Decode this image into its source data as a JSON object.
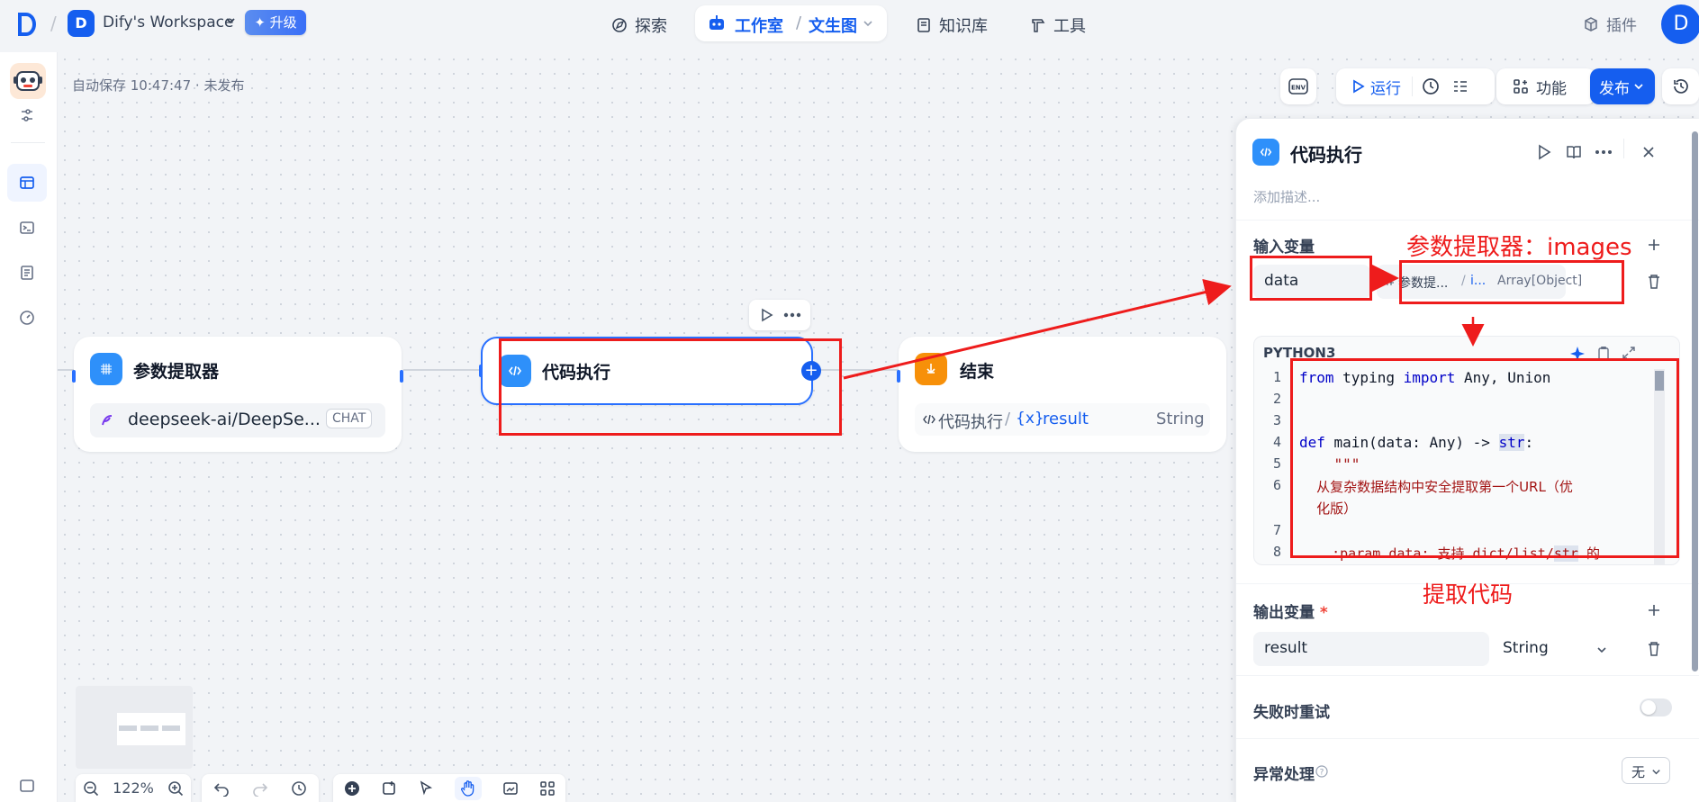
{
  "topbar": {
    "workspace_initial": "D",
    "workspace_name": "Dify's Workspace",
    "upgrade_label": "✦ 升级",
    "nav": {
      "explore": "探索",
      "studio": "工作室",
      "studio_sep": "/",
      "current_app": "文生图",
      "knowledge": "知识库",
      "tools": "工具"
    },
    "plugins": "插件",
    "avatar_initial": "D"
  },
  "canvas": {
    "autosave": "自动保存 10:47:47 · 未发布",
    "toolbar": {
      "env": "ENV",
      "run": "运行",
      "features": "功能",
      "publish": "发布"
    },
    "zoom": "122%"
  },
  "nodes": {
    "param_extractor": {
      "title": "参数提取器",
      "model": "deepseek-ai/DeepSe...",
      "badge": "CHAT"
    },
    "code": {
      "title": "代码执行"
    },
    "end": {
      "title": "结束",
      "var_source": "代码执行",
      "var_sep": "/",
      "var_name": "result",
      "var_type": "String"
    }
  },
  "panel": {
    "title": "代码执行",
    "description_placeholder": "添加描述...",
    "input_vars_label": "输入变量",
    "input_var_name": "data",
    "input_var_source": "参数提...",
    "input_var_sep": "/",
    "input_var_field": "i...",
    "input_var_type": "Array[Object]",
    "language": "PYTHON3",
    "code_lines": [
      "1",
      "2",
      "3",
      "4",
      "5",
      "6",
      "7",
      "8"
    ],
    "code": {
      "l1_a": "from",
      "l1_b": " typing ",
      "l1_c": "import",
      "l1_d": " Any, Union",
      "l4_a": "def",
      "l4_b": " main(data: Any) -> ",
      "l4_c": "str",
      "l4_d": ":",
      "l5": "    \"\"\"",
      "l6a": "    从复杂数据结构中安全提取第一个URL（优",
      "l6b": "    化版）",
      "l8_a": "    :param data: 支持 dict/list/",
      "l8_b": "str",
      "l8_c": " 的"
    },
    "output_vars_label": "输出变量",
    "output_required": "*",
    "output_var_name": "result",
    "output_var_type": "String",
    "retry_label": "失败时重试",
    "error_label": "异常处理",
    "error_value": "无"
  },
  "annotations": {
    "extractor_label": "参数提取器：images",
    "code_label": "提取代码"
  },
  "colors": {
    "primary": "#155eef",
    "annotation_red": "#ee1c1c",
    "extractor_blue": "#2e90fa",
    "end_orange": "#f79009"
  }
}
